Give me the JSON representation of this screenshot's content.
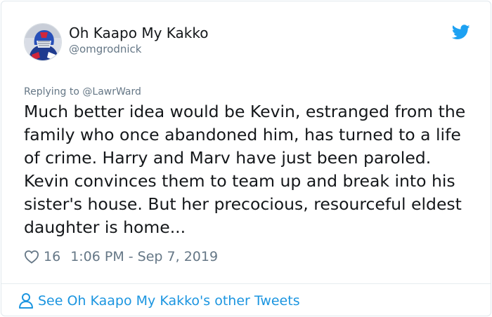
{
  "author": {
    "display_name": "Oh Kaapo My Kakko",
    "handle": "@omgrodnick",
    "avatar_icon": "goalie-avatar"
  },
  "reply": {
    "prefix": "Replying to ",
    "mention": "@LawrWard"
  },
  "tweet": {
    "text": "Much better idea would be Kevin, estranged from the family who once abandoned him, has turned to a life of crime. Harry and Marv have just been paroled. Kevin convinces them to team up and break into his sister's house. But her precocious, resourceful eldest daughter is home..."
  },
  "meta": {
    "likes": "16",
    "timestamp": "1:06 PM - Sep 7, 2019"
  },
  "footer": {
    "link_text": "See Oh Kaapo My Kakko's other Tweets"
  },
  "colors": {
    "twitter_blue": "#1da1f2",
    "link_blue": "#1b95e0",
    "secondary_text": "#657786"
  }
}
